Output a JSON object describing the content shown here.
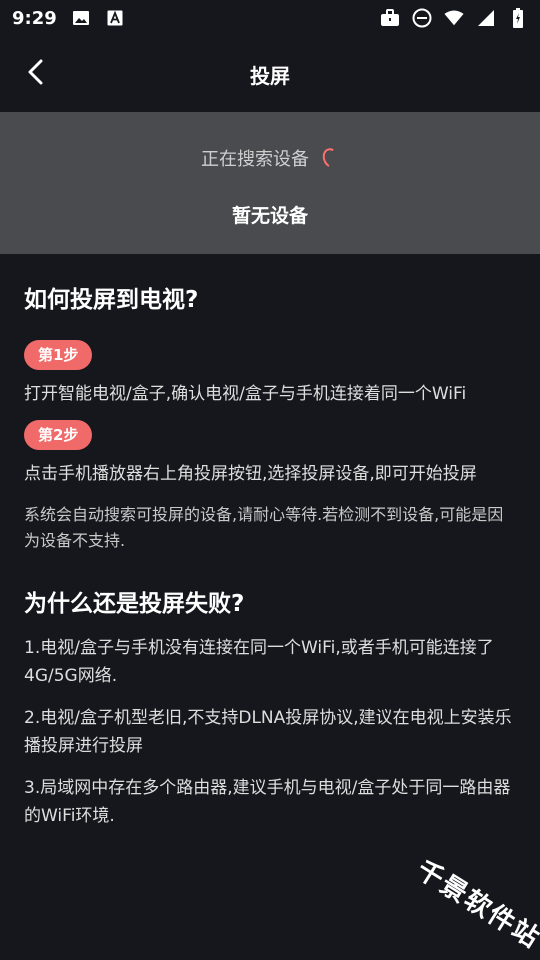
{
  "status_bar": {
    "time": "9:29",
    "icons": [
      "image-icon",
      "a-letter-icon",
      "briefcase-icon",
      "do-not-disturb-icon",
      "wifi-icon",
      "signal-icon",
      "battery-icon"
    ]
  },
  "header": {
    "title": "投屏",
    "back_icon": "chevron-left-icon"
  },
  "search": {
    "status": "正在搜索设备",
    "no_device": "暂无设备",
    "spinner_color": "#ff6f6f"
  },
  "guide": {
    "title": "如何投屏到电视?",
    "step1_label": "第1步",
    "step1_text": "打开智能电视/盒子,确认电视/盒子与手机连接着同一个WiFi",
    "step2_label": "第2步",
    "step2_text": "点击手机播放器右上角投屏按钮,选择投屏设备,即可开始投屏",
    "note": "系统会自动搜索可投屏的设备,请耐心等待.若检测不到设备,可能是因为设备不支持."
  },
  "faq": {
    "title": "为什么还是投屏失败?",
    "reason1": "1.电视/盒子与手机没有连接在同一个WiFi,或者手机可能连接了4G/5G网络.",
    "reason2": "2.电视/盒子机型老旧,不支持DLNA投屏协议,建议在电视上安装乐播投屏进行投屏",
    "reason3": "3.局域网中存在多个路由器,建议手机与电视/盒子处于同一路由器的WiFi环境."
  },
  "watermark": "千景软件站",
  "colors": {
    "background": "#16171d",
    "panel": "#4a4b4f",
    "accent": "#f06a6a"
  }
}
